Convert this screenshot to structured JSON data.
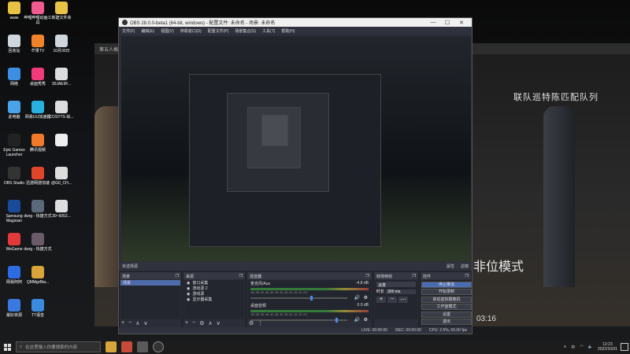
{
  "desktop_icons": [
    {
      "label": "www",
      "color": "#e8c244",
      "col": 0,
      "row": 0
    },
    {
      "label": "回收站",
      "color": "#cfd6dd",
      "col": 0,
      "row": 1
    },
    {
      "label": "网络",
      "color": "#3c8fe0",
      "col": 0,
      "row": 2
    },
    {
      "label": "此电脑",
      "color": "#4aa3e8",
      "col": 0,
      "row": 3
    },
    {
      "label": "Epic Games Launcher",
      "color": "#222",
      "col": 0,
      "row": 4
    },
    {
      "label": "OBS Studio",
      "color": "#333",
      "col": 0,
      "row": 5
    },
    {
      "label": "Samsung Magician",
      "color": "#1a4a9a",
      "col": 0,
      "row": 6
    },
    {
      "label": "WeGame",
      "color": "#e23a3a",
      "col": 0,
      "row": 7
    },
    {
      "label": "网易阿阿",
      "color": "#2d6ce0",
      "col": 0,
      "row": 8
    },
    {
      "label": "最好资源",
      "color": "#3a7ae0",
      "col": 0,
      "row": 9
    },
    {
      "label": "哔哩哔哩动画工具",
      "color": "#f05a8e",
      "col": 1,
      "row": 0
    },
    {
      "label": "芒果TV",
      "color": "#f0832a",
      "col": 1,
      "row": 1
    },
    {
      "label": "桌面秀秀",
      "color": "#f03a7a",
      "col": 1,
      "row": 2
    },
    {
      "label": "网易UU加速器",
      "color": "#2ab0e0",
      "col": 1,
      "row": 3
    },
    {
      "label": "腾讯视频",
      "color": "#f07a2a",
      "col": 1,
      "row": 4
    },
    {
      "label": "迅游网游加速",
      "color": "#e0452a",
      "col": 1,
      "row": 5
    },
    {
      "label": "dwrg - 快捷方式",
      "color": "#5a6a7a",
      "col": 1,
      "row": 6
    },
    {
      "label": "dwrg - 快捷方式",
      "color": "#6a5a6a",
      "col": 1,
      "row": 7
    },
    {
      "label": "QMMgrBta...",
      "color": "#d9a43a",
      "col": 1,
      "row": 8
    },
    {
      "label": "TT语音",
      "color": "#3a8ae0",
      "col": 1,
      "row": 9
    },
    {
      "label": "新建文件夹",
      "color": "#e8c244",
      "col": 2,
      "row": 0
    },
    {
      "label": "10月30日",
      "color": "#cfd6dd",
      "col": 2,
      "row": 1
    },
    {
      "label": "30JAE9F...",
      "color": "#ddd",
      "col": 2,
      "row": 2
    },
    {
      "label": "COSYTS 绘...",
      "color": "#ddd",
      "col": 2,
      "row": 3
    },
    {
      "label": "",
      "color": "#eee",
      "col": 2,
      "row": 4
    },
    {
      "label": "@G0_CH...",
      "color": "#ddd",
      "col": 2,
      "row": 5
    },
    {
      "label": "30~6052...",
      "color": "#ddd",
      "col": 2,
      "row": 6
    }
  ],
  "background_window": {
    "title": "第五人格",
    "art_title": "联队巡特陈匹配队列",
    "mode_text": "非位模式",
    "timer": "03:16"
  },
  "obs": {
    "title": "OBS 28.0.0-beta1 (64-bit, windows) - 配置文件: 未命名 - 场景: 未命名",
    "window_buttons": [
      "—",
      "☐",
      "✕"
    ],
    "menu": [
      "文件(F)",
      "编辑(E)",
      "视图(V)",
      "停靠窗口(D)",
      "配置文件(P)",
      "场景集合(S)",
      "工具(T)",
      "帮助(H)"
    ],
    "source_bar": {
      "left": "未选择源",
      "tabs": [
        "属性",
        "滤镜"
      ]
    },
    "scenes": {
      "title": "场景",
      "items": [
        "场景"
      ]
    },
    "sources": {
      "title": "来源",
      "items": [
        "窗口采集",
        "游戏源 2",
        "游戏源",
        "显示器采集"
      ]
    },
    "mixer": {
      "title": "混音器",
      "channels": [
        {
          "name": "麦克风/Aux",
          "db": "-4.8 dB",
          "level": 0.62
        },
        {
          "name": "桌面音频",
          "db": "0.0 dB",
          "level": 0.88
        }
      ],
      "scale": "-60 -55 -50 -45 -40 -35 -30 -25 -20 -15 -10 -5 0"
    },
    "transitions": {
      "title": "转场特效",
      "type": "淡变",
      "duration_label": "时长",
      "duration": "300 ms"
    },
    "controls": {
      "title": "控件",
      "buttons": [
        "停止推流",
        "开始录制",
        "启动虚拟摄像机",
        "工作室模式",
        "设置",
        "退出"
      ]
    },
    "status": {
      "live": "LIVE: 00:00:00",
      "rec": "REC: 00:00:00",
      "cpu": "CPU: 2.5%, 60.00 fps"
    }
  },
  "taskbar": {
    "search_placeholder": "在这里输入你要搜索的内容",
    "time": "12:23",
    "date": "2022/10/31",
    "ime": "中"
  }
}
